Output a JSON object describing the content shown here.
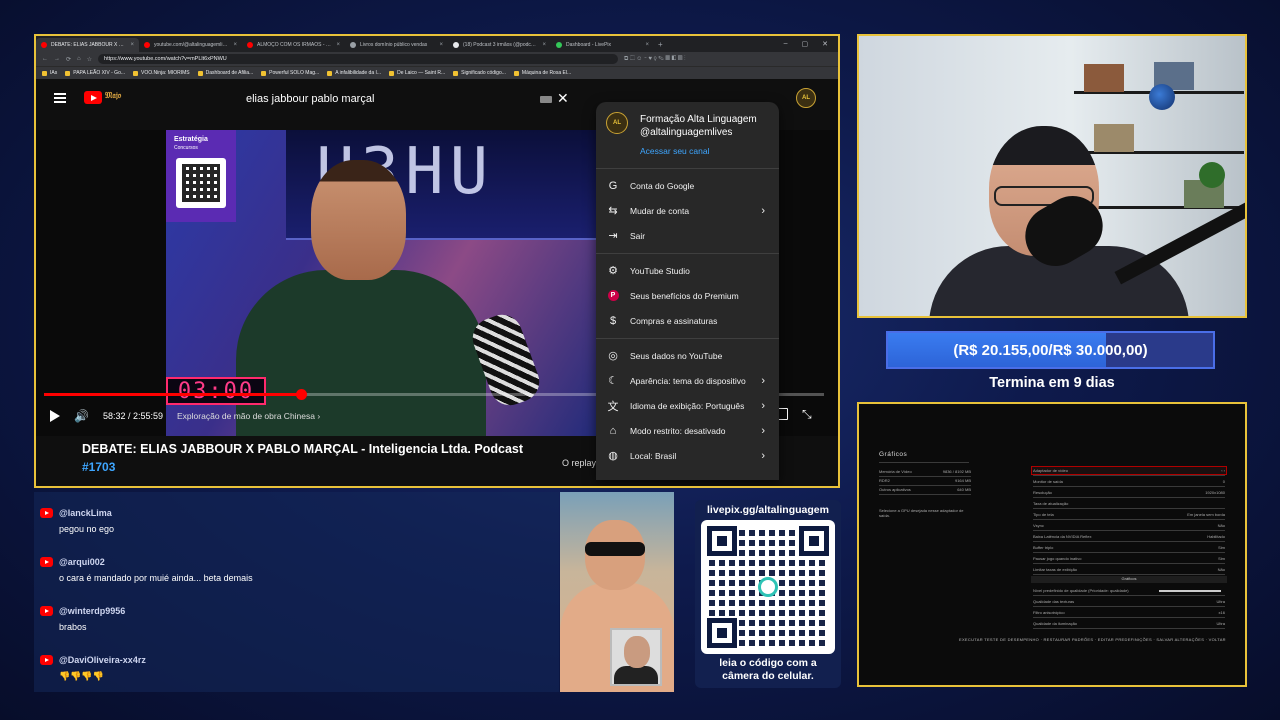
{
  "browser": {
    "tabs": [
      {
        "title": "DEBATE: ELIAS JABBOUR X PABLO",
        "color": "#ff0000",
        "active": true
      },
      {
        "title": "youtube.com/@altalinguagemlives",
        "color": "#ff0000"
      },
      {
        "title": "ALMOÇO COM OS IRMÃOS - CONVI",
        "color": "#ff0000"
      },
      {
        "title": "Livros domínio público vendas",
        "color": "#9aa0a6"
      },
      {
        "title": "(18) Podcast 3 irmãos (@podcast3irm",
        "color": "#e8eaed"
      },
      {
        "title": "Dashboard - LivePix",
        "color": "#34c759"
      }
    ],
    "new_tab": "+",
    "window_controls": [
      "–",
      "▢",
      "✕"
    ],
    "url": "https://www.youtube.com/watch?v=mPLlt6xPNWU",
    "bookmarks": [
      "IAs",
      "PAPA LEÃO XIV - Go...",
      "VOO.Ninja: MIORIMS",
      "Dashboard de Afilia...",
      "Powerful SOLO Mag...",
      "A infalibilidade da I...",
      "De Laico — Saint R...",
      "Significado código...",
      "Máquina de Rosa El..."
    ]
  },
  "youtube": {
    "search_value": "elias jabbour pablo marçal",
    "doodle": "𝔐𝔞𝔧𝔬",
    "avatar_text": "AL",
    "video": {
      "sponsor": "Estratégia",
      "sponsor_sub": "Concursos",
      "led_text": "U3HU",
      "clock": "03:00",
      "progress": 0.33,
      "time": "58:32 / 2:55:59",
      "chapter": "Exploração de mão de obra Chinesa  ›",
      "title": "DEBATE: ELIAS JABBOUR X PABLO MARÇAL - Inteligencia Ltda. Podcast",
      "tag": "#1703",
      "replay": "O replay"
    },
    "account_menu": {
      "name": "Formação Alta Linguagem",
      "handle": "@altalinguagemlives",
      "channel_link": "Acessar seu canal",
      "groups": [
        [
          {
            "label": "Conta do Google",
            "icon": "google-icon",
            "glyph": "G",
            "arrow": false
          },
          {
            "label": "Mudar de conta",
            "icon": "switch-account-icon",
            "glyph": "⇆",
            "arrow": true
          },
          {
            "label": "Sair",
            "icon": "sign-out-icon",
            "glyph": "⇥",
            "arrow": false
          }
        ],
        [
          {
            "label": "YouTube Studio",
            "icon": "studio-icon",
            "glyph": "⚙",
            "arrow": false
          },
          {
            "label": "Seus benefícios do Premium",
            "icon": "premium-icon",
            "glyph": "P",
            "arrow": false
          },
          {
            "label": "Compras e assinaturas",
            "icon": "purchases-icon",
            "glyph": "$",
            "arrow": false
          }
        ],
        [
          {
            "label": "Seus dados no YouTube",
            "icon": "data-icon",
            "glyph": "◎",
            "arrow": false
          },
          {
            "label": "Aparência: tema do dispositivo",
            "icon": "appearance-icon",
            "glyph": "☾",
            "arrow": true
          },
          {
            "label": "Idioma de exibição: Português",
            "icon": "language-icon",
            "glyph": "文",
            "arrow": true
          },
          {
            "label": "Modo restrito: desativado",
            "icon": "restricted-icon",
            "glyph": "⌂",
            "arrow": true
          },
          {
            "label": "Local: Brasil",
            "icon": "location-icon",
            "glyph": "◍",
            "arrow": true
          }
        ]
      ]
    }
  },
  "goal": {
    "text": "(R$ 20.155,00/R$ 30.000,00)",
    "progress": 0.67,
    "ends": "Termina em 9 dias"
  },
  "game": {
    "title": "Gráficos",
    "left_rows": [
      {
        "label": "Memória de Vídeo",
        "value": "9836 / 8192 MB"
      },
      {
        "label": "RDR2",
        "value": "9164 MB"
      },
      {
        "label": "Outros aplicativos",
        "value": "640 MB"
      }
    ],
    "note": "Selecione a GPU desejada nesse adaptador de saída.",
    "right_rows": [
      {
        "label": "Adaptador de vídeo",
        "value": "‹ ›"
      },
      {
        "label": "Monitor de saída",
        "value": "0"
      },
      {
        "label": "Resolução",
        "value": "1920x1080"
      },
      {
        "label": "Taxa de atualização",
        "value": ""
      },
      {
        "label": "Tipo de tela",
        "value": "Em janela sem borda"
      },
      {
        "label": "Vsync",
        "value": "Não"
      },
      {
        "label": "Baixa Latência da NVIDIA Reflex",
        "value": "Habilitado"
      },
      {
        "label": "Buffer triplo",
        "value": "Sim"
      },
      {
        "label": "Pausar jogo quando inativo",
        "value": "Sim"
      },
      {
        "label": "Limitar taxas de exibição",
        "value": "Não"
      }
    ],
    "section": "Gráficos",
    "right_rows2": [
      {
        "label": "Nível predefinido de qualidade (Prioridade: qualidade)",
        "value": ""
      },
      {
        "label": "Qualidade das texturas",
        "value": "Ultra"
      },
      {
        "label": "Filtro anisotrópico",
        "value": "x16"
      },
      {
        "label": "Qualidade da iluminação",
        "value": "Ultra"
      }
    ],
    "footer": "EXECUTAR TESTE DE DESEMPENHO  ·  RESTAURAR PADRÕES  ·  EDITAR PREDEFINIÇÕES  ·  SALVAR ALTERAÇÕES  ·  VOLTAR"
  },
  "chat": [
    {
      "user": "@lanckLima",
      "message": "pegou no ego"
    },
    {
      "user": "@arqui002",
      "message": "o cara é mandado por muié ainda... beta demais"
    },
    {
      "user": "@winterdp9956",
      "message": "brabos"
    },
    {
      "user": "@DaviOliveira-xx4rz",
      "message": "👎👎👎👎"
    }
  ],
  "livepix": {
    "handle": "livepix.gg/altalinguagem",
    "caption1": "leia o código com a",
    "caption2": "câmera do celular."
  }
}
